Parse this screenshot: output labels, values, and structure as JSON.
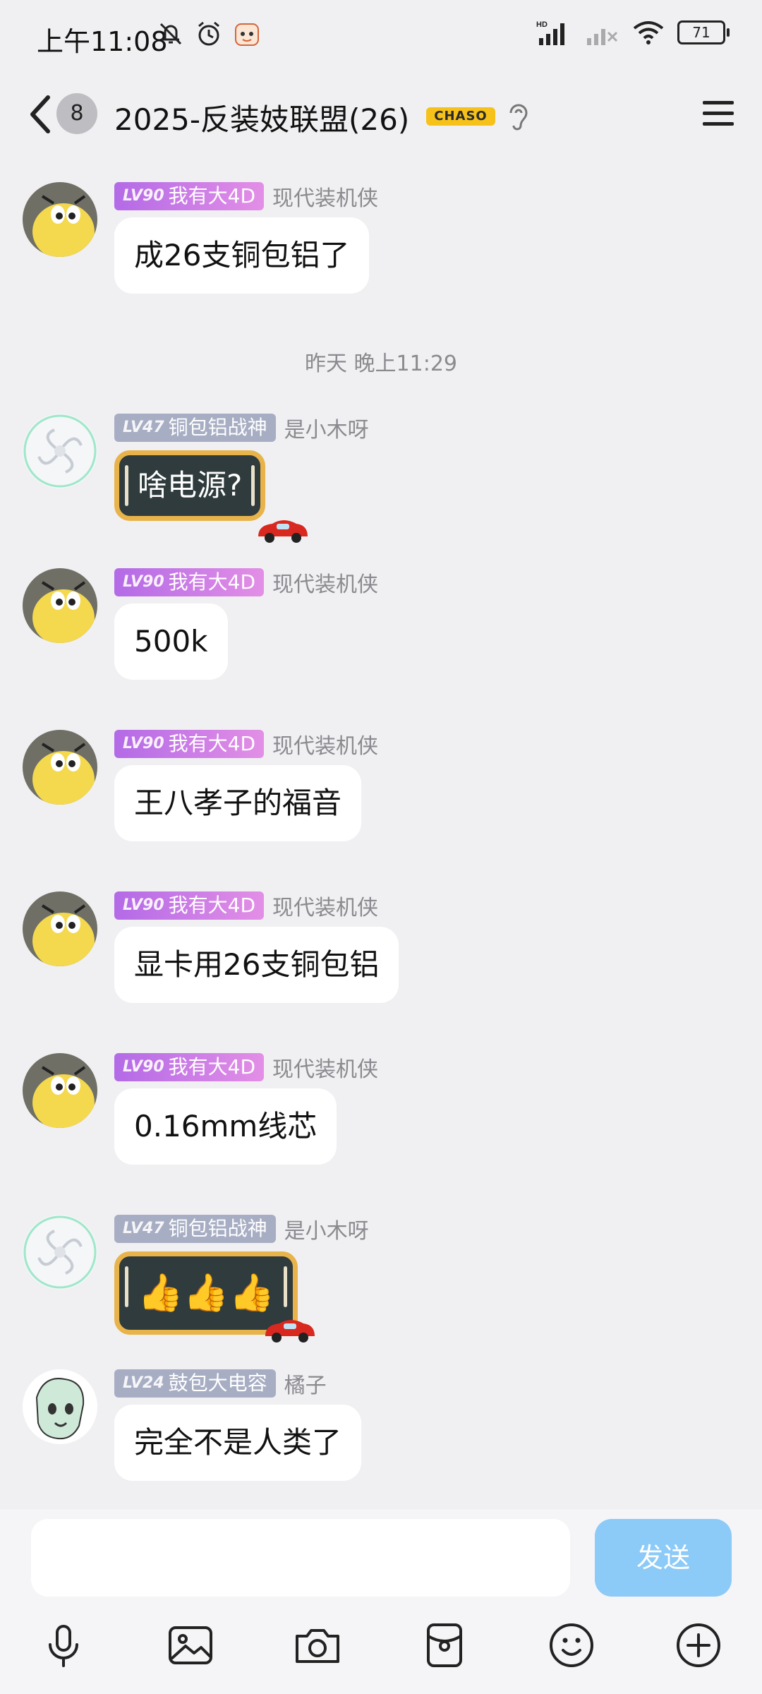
{
  "status_bar": {
    "time": "上午11:08",
    "battery": "71",
    "network_label": "HD"
  },
  "header": {
    "unread_count": "8",
    "title": "2025-反装妓联盟(26)",
    "badge": "CHASO"
  },
  "messages": [
    {
      "level": "LV90",
      "title": "我有大4D",
      "nick": "现代装机侠",
      "text": "成26支铜包铝了"
    },
    {
      "timestamp": "昨天 晚上11:29"
    },
    {
      "level": "LV47",
      "title": "铜包铝战神",
      "nick": "是小木呀",
      "text": "啥电源?"
    },
    {
      "level": "LV90",
      "title": "我有大4D",
      "nick": "现代装机侠",
      "text": "500k"
    },
    {
      "level": "LV90",
      "title": "我有大4D",
      "nick": "现代装机侠",
      "text": "王八孝子的福音"
    },
    {
      "level": "LV90",
      "title": "我有大4D",
      "nick": "现代装机侠",
      "text": "显卡用26支铜包铝"
    },
    {
      "level": "LV90",
      "title": "我有大4D",
      "nick": "现代装机侠",
      "text": "0.16mm线芯"
    },
    {
      "level": "LV47",
      "title": "铜包铝战神",
      "nick": "是小木呀",
      "text": "👍👍👍"
    },
    {
      "level": "LV24",
      "title": "鼓包大电容",
      "nick": "橘子",
      "text": "完全不是人类了"
    }
  ],
  "input": {
    "value": "",
    "send_label": "发送"
  },
  "toolbar": [
    "microphone-icon",
    "image-icon",
    "camera-icon",
    "red-packet-icon",
    "emoji-icon",
    "plus-icon"
  ],
  "colors": {
    "send_button": "#8ccaf7",
    "badge_purple": "#b36ae6",
    "badge_gray": "#a7adc3",
    "special_bubble": "#2f3b3d"
  }
}
